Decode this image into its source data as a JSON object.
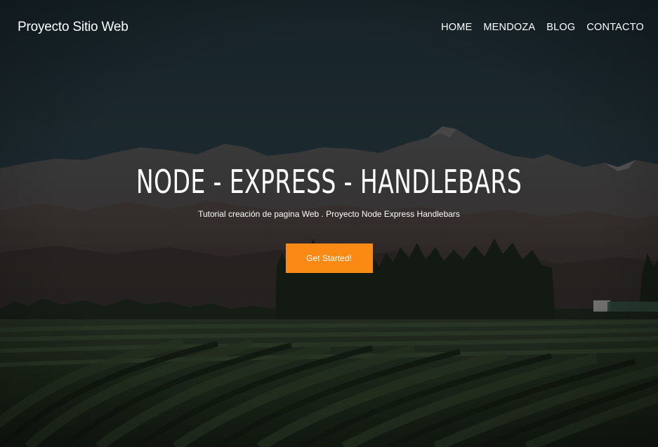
{
  "navbar": {
    "brand": "Proyecto Sitio Web",
    "links": [
      {
        "label": "HOME"
      },
      {
        "label": "MENDOZA"
      },
      {
        "label": "BLOG"
      },
      {
        "label": "CONTACTO"
      }
    ]
  },
  "hero": {
    "title": "NODE - EXPRESS - HANDLEBARS",
    "subtitle": "Tutorial creación de pagina Web . Proyecto Node Express Handlebars",
    "cta_label": "Get Started!"
  },
  "colors": {
    "accent": "#fa8a14",
    "text": "#ffffff",
    "sky_top": "#1c2a30",
    "vineyard": "#1e2a18"
  }
}
